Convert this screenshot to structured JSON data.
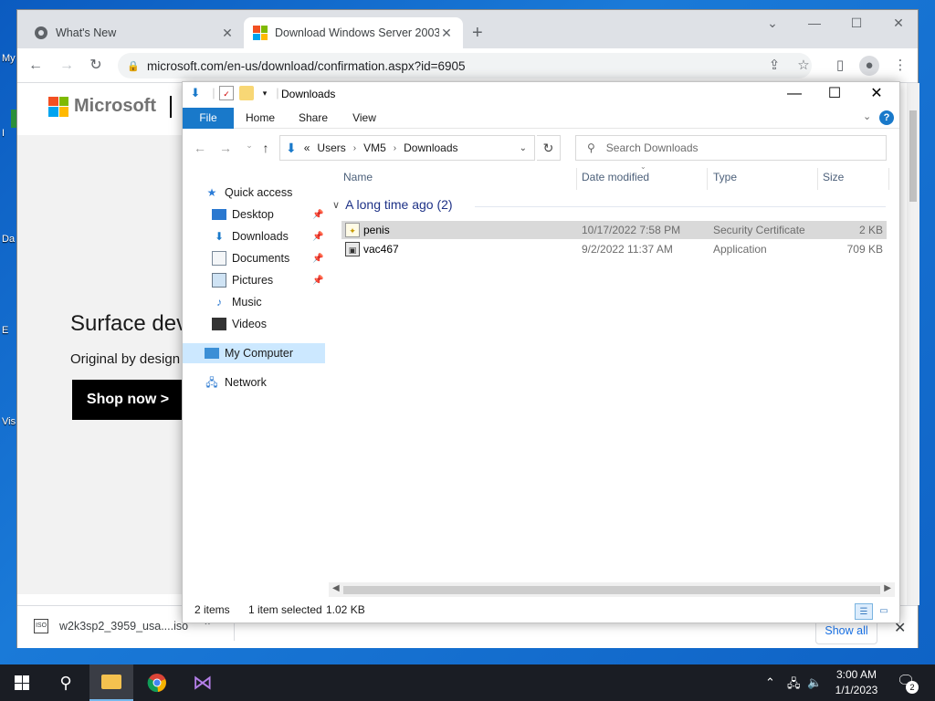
{
  "desktop": {
    "labels": [
      "My",
      "I",
      "Da",
      "E",
      "Vis"
    ]
  },
  "chrome": {
    "tabs": [
      {
        "label": "What's New",
        "icon": "chrome-icon"
      },
      {
        "label": "Download Windows Server 2003",
        "icon": "microsoft-icon"
      }
    ],
    "url": "microsoft.com/en-us/download/confirmation.aspx?id=6905",
    "page": {
      "brand": "Microsoft",
      "hero_title": "Surface devic",
      "hero_sub": "Original by design",
      "shop_label": "Shop now >"
    },
    "download_shelf": {
      "file_label": "w2k3sp2_3959_usa....iso",
      "file_icon_text": "ISO",
      "show_all": "Show all"
    }
  },
  "explorer": {
    "title": "Downloads",
    "ribbon_tabs": [
      "File",
      "Home",
      "Share",
      "View"
    ],
    "breadcrumb": [
      "Users",
      "VM5",
      "Downloads"
    ],
    "breadcrumb_prefix": "«",
    "search_placeholder": "Search Downloads",
    "nav": {
      "quick_access": "Quick access",
      "items": [
        {
          "label": "Desktop",
          "pinned": true
        },
        {
          "label": "Downloads",
          "pinned": true
        },
        {
          "label": "Documents",
          "pinned": true
        },
        {
          "label": "Pictures",
          "pinned": true
        },
        {
          "label": "Music",
          "pinned": false
        },
        {
          "label": "Videos",
          "pinned": false
        }
      ],
      "my_computer": "My Computer",
      "network": "Network"
    },
    "columns": [
      "Name",
      "Date modified",
      "Type",
      "Size"
    ],
    "group_label": "A long time ago (2)",
    "files": [
      {
        "name": "penis",
        "date": "10/17/2022 7:58 PM",
        "type": "Security Certificate",
        "size": "2 KB",
        "selected": true
      },
      {
        "name": "vac467",
        "date": "9/2/2022 11:37 AM",
        "type": "Application",
        "size": "709 KB",
        "selected": false
      }
    ],
    "status": {
      "items": "2 items",
      "selected": "1 item selected",
      "size": "1.02 KB"
    }
  },
  "taskbar": {
    "time": "3:00 AM",
    "date": "1/1/2023",
    "notifications": "2"
  }
}
